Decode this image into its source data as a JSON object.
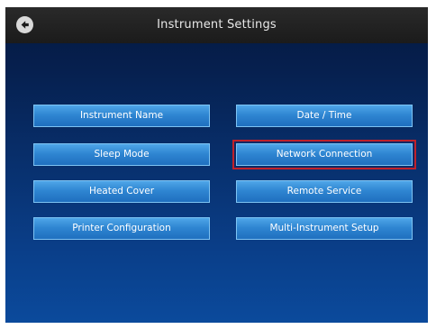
{
  "header": {
    "title": "Instrument Settings",
    "back_icon": "arrow-left-icon"
  },
  "buttons": {
    "instrument_name": "Instrument Name",
    "date_time": "Date / Time",
    "sleep_mode": "Sleep Mode",
    "network_connection": "Network Connection",
    "heated_cover": "Heated Cover",
    "remote_service": "Remote Service",
    "printer_configuration": "Printer Configuration",
    "multi_instrument_setup": "Multi-Instrument Setup"
  },
  "selected_button": "Network Connection",
  "colors": {
    "header_bg": "#1f1f1f",
    "screen_bg": "#0a3f8a",
    "button_bg": "#2f86d2",
    "highlight": "#c0212a"
  }
}
